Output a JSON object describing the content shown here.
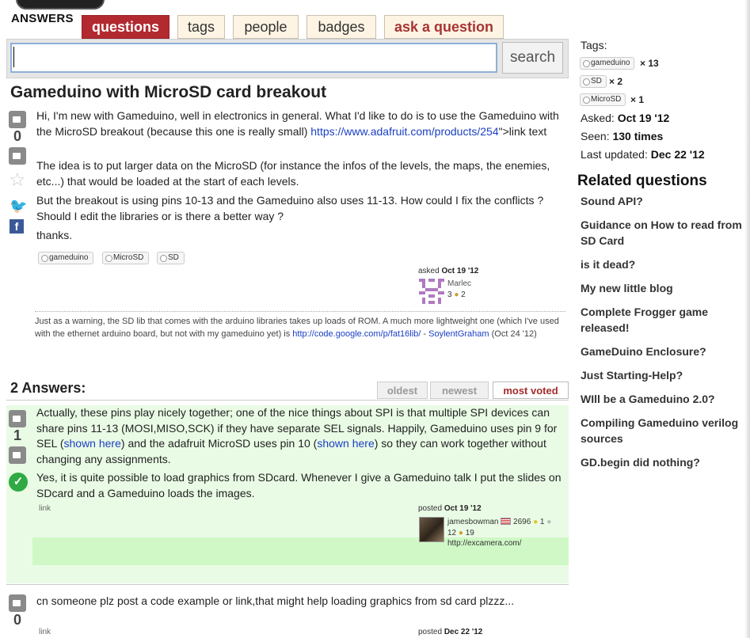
{
  "header": {
    "logo_text": "ANSWERS",
    "tabs": [
      {
        "label": "questions",
        "active": true
      },
      {
        "label": "tags"
      },
      {
        "label": "people"
      },
      {
        "label": "badges"
      },
      {
        "label": "ask a question"
      }
    ],
    "search": {
      "button_label": "search",
      "value": "",
      "placeholder": ""
    }
  },
  "question": {
    "title": "Gameduino with MicroSD card breakout",
    "votes": "0",
    "paragraph1_text": "Hi, I'm new with Gameduino, well in electronics in general. What I'd like to do is to use the Gameduino with the MicroSD breakout (because this one is really small) ",
    "paragraph1_link": "https://www.adafruit.com/products/254",
    "paragraph1_tail": "\">link text",
    "paragraph2": "The idea is to put larger data on the MicroSD (for instance the infos of the levels, the maps, the enemies, etc...) that would be loaded at the start of each levels.",
    "paragraph3": "But the breakout is using pins 10-13 and the Gameduino also uses 11-13. How could I fix the conflicts ? Should I edit the libraries or is there a better way ?",
    "paragraph4": "thanks.",
    "tags": [
      "gameduino",
      "MicroSD",
      "SD"
    ],
    "asked_label": "asked",
    "asked_date": "Oct 19 '12",
    "author": "Marlec",
    "author_rep": "3",
    "author_badges": "2",
    "comment_text": "Just as a warning, the SD lib that comes with the arduino libraries takes up loads of ROM. A much more lightweight one (which I've used with the ethernet arduino board, but not with my gameduino yet) is ",
    "comment_link": "http://code.google.com/p/fat16lib/",
    "comment_sep": " - ",
    "comment_author": "SoylentGraham",
    "comment_date": " (Oct 24 '12)"
  },
  "answers_section": {
    "heading": "2 Answers:",
    "sort_tabs": [
      {
        "label": "oldest"
      },
      {
        "label": "newest"
      },
      {
        "label": "most voted",
        "active": true
      }
    ]
  },
  "answers": [
    {
      "votes": "1",
      "accepted": true,
      "p1_a": "Actually, these pins play nicely together; one of the nice things about SPI is that multiple SPI devices can share pins 11-13 (MOSI,MISO,SCK) if they have separate SEL signals. Happily, Gameduino uses pin 9 for SEL (",
      "p1_link1": "shown here",
      "p1_b": ") and the adafruit MicroSD uses pin 10 (",
      "p1_link2": "shown here",
      "p1_c": ") so they can work together without changing any assignments.",
      "p2": "Yes, it is quite possible to load graphics from SDcard. Whenever I give a Gameduino talk I put the slides on SDcard and a Gameduino loads the images.",
      "link_label": "link",
      "posted_label": "posted",
      "posted_date": "Oct 19 '12",
      "author": "jamesbowman",
      "author_rep": "2696",
      "badge_gold": "1",
      "badge_silver": "12",
      "badge_bronze": "19",
      "author_url": "http://excamera.com/"
    },
    {
      "votes": "0",
      "text": "cn someone plz post a code example or link,that might help loading graphics from sd card plzzz...",
      "link_label": "link",
      "posted_label": "posted",
      "posted_date": "Dec 22 '12"
    }
  ],
  "sidebar": {
    "tags_label": "Tags:",
    "tags": [
      {
        "name": "gameduino",
        "count": "× 13"
      },
      {
        "name": "SD",
        "count": "× 2"
      },
      {
        "name": "MicroSD",
        "count": "× 1"
      }
    ],
    "asked_label": "Asked:",
    "asked_value": "Oct 19 '12",
    "seen_label": "Seen:",
    "seen_value": "130 times",
    "updated_label": "Last updated:",
    "updated_value": "Dec 22 '12",
    "related_heading": "Related questions",
    "related": [
      "Sound API?",
      "Guidance on How to read from SD Card",
      "is it dead?",
      "My new little blog",
      "Complete Frogger game released!",
      "GameDuino Enclosure?",
      "Just Starting-Help?",
      "WIll be a Gameduino 2.0?",
      "Compiling Gameduino verilog sources",
      "GD.begin did nothing?"
    ]
  },
  "colors": {
    "active_tab": "#b22a30",
    "tab_bg": "#fdf4e4",
    "link": "#1a3fc4",
    "accepted_bg": "#e9fbe5",
    "accepted_footer": "#cff8c6",
    "accept_check": "#2faa44"
  }
}
